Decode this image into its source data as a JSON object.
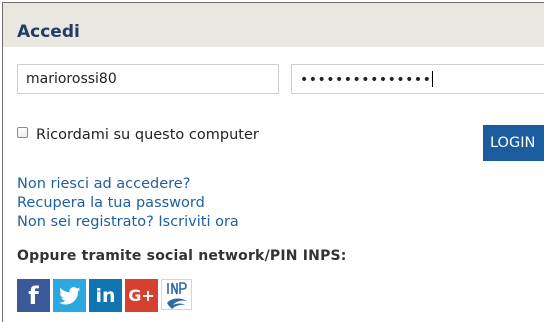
{
  "form": {
    "title": "Accedi",
    "username_value": "mariorossi80",
    "password_masked": "•••••••••••••••",
    "remember_label": "Ricordami su questo computer",
    "login_label": "LOGIN"
  },
  "links": [
    "Non riesci ad accedere?",
    "Recupera la tua password",
    "Non sei registrato? Iscriviti ora"
  ],
  "social": {
    "title": "Oppure tramite social network/PIN INPS:",
    "facebook": "f",
    "linkedin": "in",
    "googleplus": "G+"
  },
  "colors": {
    "header_bg": "#eae7e1",
    "accent": "#1b5c9e",
    "link": "#1f5f9c"
  }
}
